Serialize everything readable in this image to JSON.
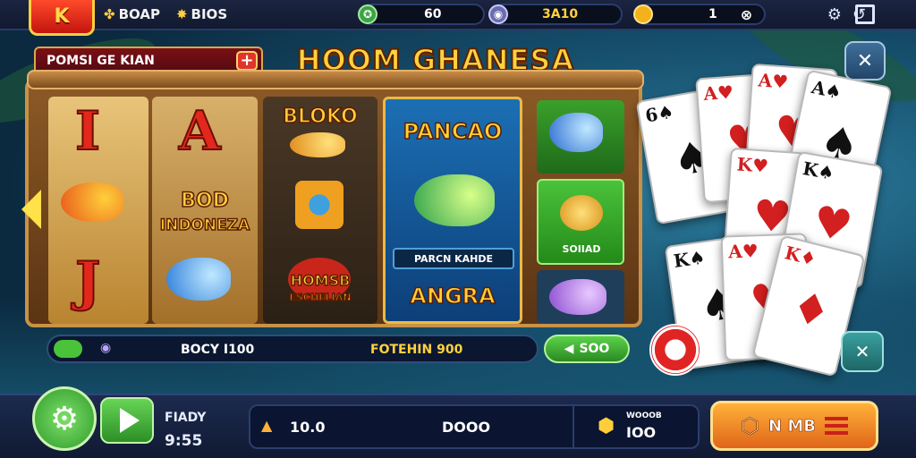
{
  "top": {
    "logo_letter": "K",
    "label_1": "BOAP",
    "label_2": "BIOS",
    "label_2_prefix": "B",
    "balance_value": "60",
    "balance_value_2": "3A10",
    "coin_value": "1"
  },
  "banner": {
    "label": "POMSI GE KIAN",
    "plus": "+"
  },
  "title": "HOOM GHANESA",
  "reels": {
    "r1_top": "I",
    "r1_bottom": "J",
    "r2_top": "A",
    "r2_word": "BOD",
    "r2_word2": "INDONEZA",
    "r3_word": "BLOKO",
    "r3_word2": "HOMSB",
    "r3_word3": "ESCHELIAN",
    "r4_title": "PANCAO",
    "r4_label": "PARCN KAHDE",
    "r4_word": "ANGRA",
    "r5_value": "SOIIAD"
  },
  "infobar": {
    "left_text": "BOCY I100",
    "right_text": "FOTEHIN 900",
    "ok_label": "SOO"
  },
  "bottom": {
    "ready_label": "FIADY",
    "time": "9:55",
    "stat_1": "10.0",
    "stat_2": "DOOO",
    "stat_3_small": "WOOOB",
    "stat_3": "IOO",
    "action_label": "N MB"
  },
  "colors": {
    "accent": "#ffd23e",
    "primary_green": "#3aa52e",
    "action_orange": "#f08a22"
  }
}
